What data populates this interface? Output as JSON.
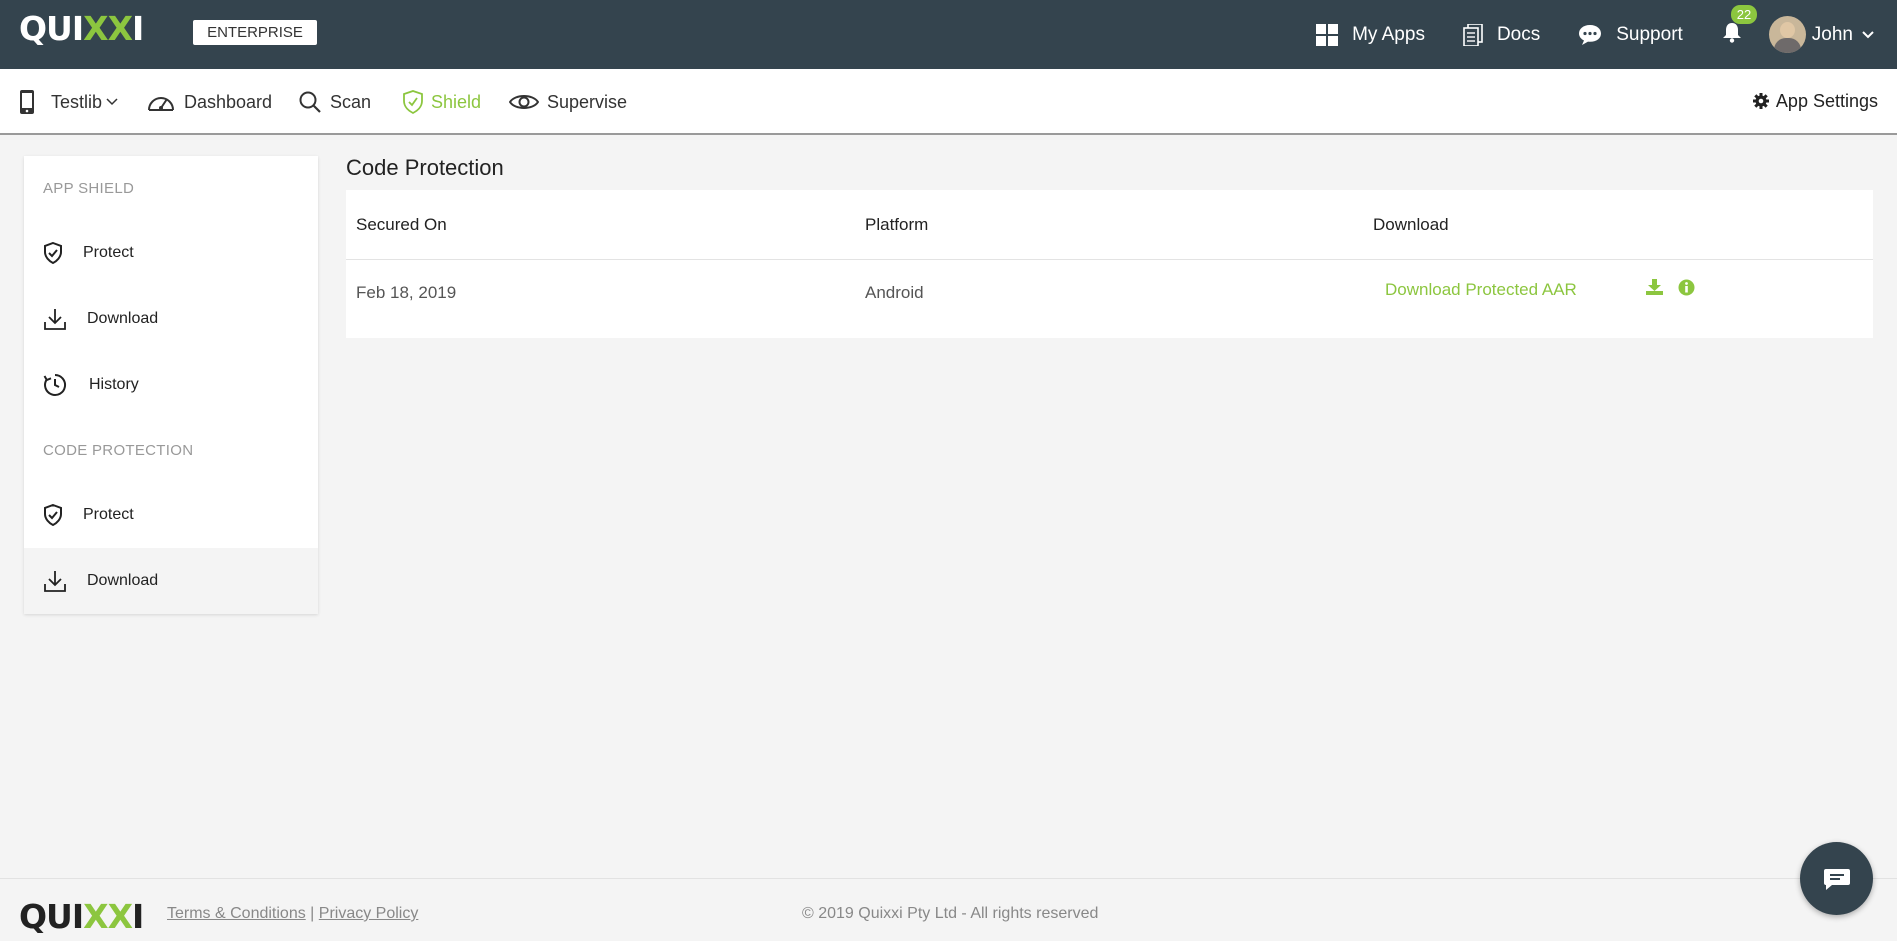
{
  "topbar": {
    "logo": "QUIXXI",
    "edition": "ENTERPRISE",
    "my_apps": "My Apps",
    "docs": "Docs",
    "support": "Support",
    "notifications_count": "22",
    "user_name": "John"
  },
  "subnav": {
    "app_name": "Testlib",
    "dashboard": "Dashboard",
    "scan": "Scan",
    "shield": "Shield",
    "supervise": "Supervise",
    "app_settings": "App Settings"
  },
  "sidebar": {
    "section1": "APP SHIELD",
    "section1_items": [
      "Protect",
      "Download",
      "History"
    ],
    "section2": "CODE PROTECTION",
    "section2_items": [
      "Protect",
      "Download"
    ]
  },
  "main": {
    "title": "Code Protection",
    "columns": [
      "Secured On",
      "Platform",
      "Download"
    ],
    "rows": [
      {
        "secured_on": "Feb 18, 2019",
        "platform": "Android",
        "download": "Download Protected AAR"
      }
    ]
  },
  "footer": {
    "terms": "Terms & Conditions",
    "separator": "|",
    "privacy": "Privacy Policy",
    "copyright": "© 2019 Quixxi Pty Ltd - All rights reserved"
  },
  "colors": {
    "topbar_bg": "#34444e",
    "accent_green": "#8cc63f",
    "page_bg": "#f4f4f4"
  },
  "icons": {
    "my_apps": "grid-icon",
    "docs": "docs-icon",
    "support": "chat-bubble-icon",
    "notifications": "bell-icon",
    "app": "phone-icon",
    "dashboard": "speedometer-icon",
    "scan": "magnifier-icon",
    "shield": "shield-icon",
    "supervise": "eye-icon",
    "settings": "gear-icon",
    "row_download": "download-icon",
    "row_info": "info-icon",
    "chat_widget": "chat-icon"
  }
}
